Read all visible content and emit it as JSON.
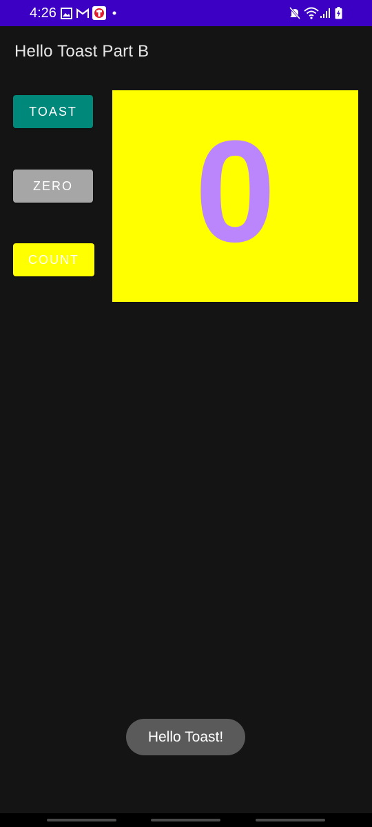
{
  "status_bar": {
    "time": "4:26",
    "background": "#3b00c4",
    "left_icons": [
      "gallery-icon",
      "gmail-icon",
      "app-notification-icon",
      "dot-icon"
    ],
    "right_icons": [
      "mute-icon",
      "wifi-icon",
      "signal-icon",
      "battery-icon"
    ]
  },
  "app_bar": {
    "title": "Hello Toast Part B"
  },
  "buttons": {
    "toast": {
      "label": "TOAST",
      "color": "#00897b"
    },
    "zero": {
      "label": "ZERO",
      "color": "#a6a6a6"
    },
    "count": {
      "label": "COUNT",
      "color": "#ffff00"
    }
  },
  "counter": {
    "value": "0",
    "background": "#ffff00",
    "text_color": "#bb86fc"
  },
  "toast_message": {
    "text": "Hello Toast!"
  }
}
